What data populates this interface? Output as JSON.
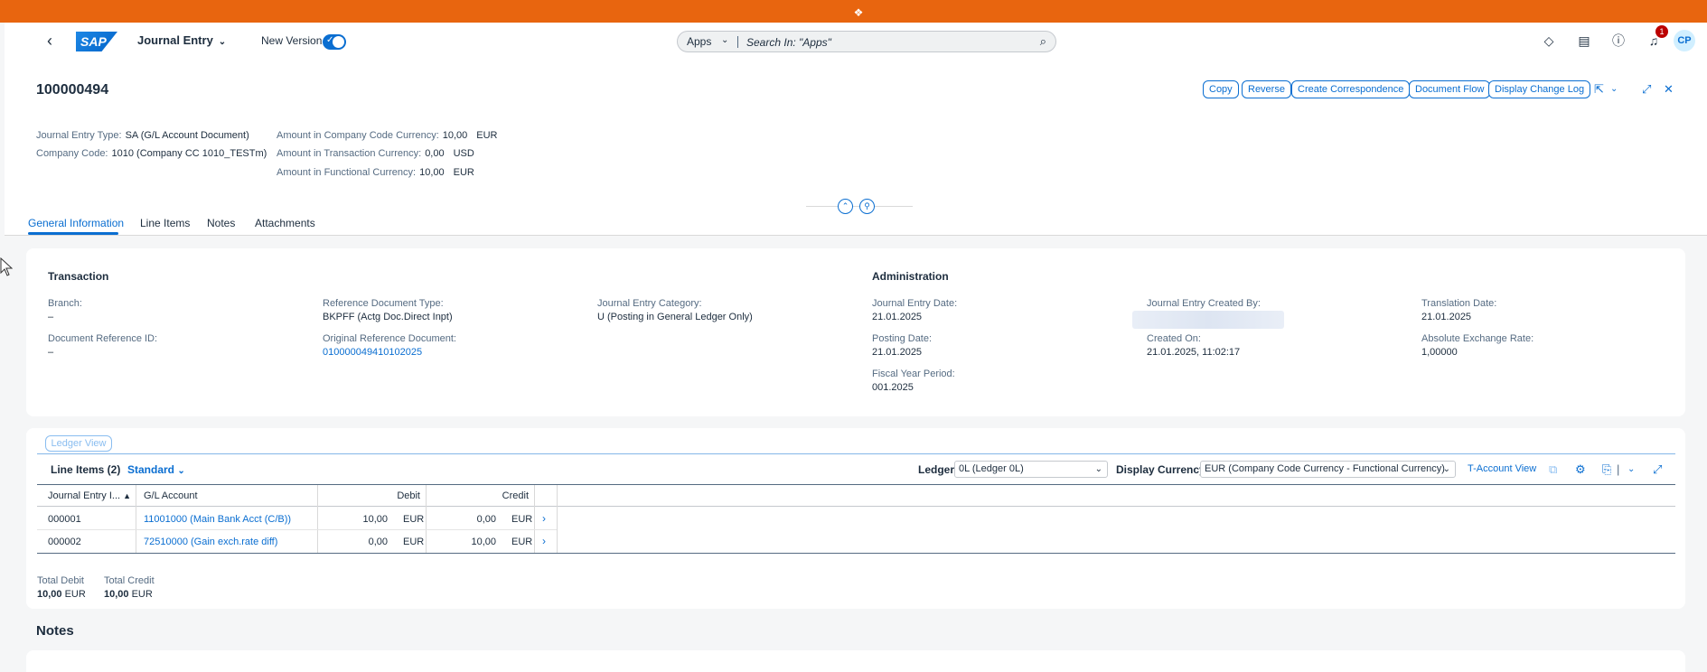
{
  "shell": {
    "app_title": "Journal Entry",
    "new_version_label": "New Version",
    "search_scope": "Apps",
    "search_placeholder": "Search In: \"Apps\"",
    "notification_count": "1",
    "avatar_initials": "CP"
  },
  "header": {
    "document_number": "100000494",
    "actions": [
      "Copy",
      "Reverse",
      "Create Correspondence",
      "Document Flow",
      "Display Change Log"
    ],
    "attributes": {
      "je_type_label": "Journal Entry Type:",
      "je_type_value": "SA (G/L Account Document)",
      "company_code_label": "Company Code:",
      "company_code_value": "1010 (Company CC 1010_TESTm)",
      "amt_cc_label": "Amount in Company Code Currency:",
      "amt_cc_value": "10,00",
      "amt_cc_currency": "EUR",
      "amt_tc_label": "Amount in Transaction Currency:",
      "amt_tc_value": "0,00",
      "amt_tc_currency": "USD",
      "amt_fc_label": "Amount in Functional Currency:",
      "amt_fc_value": "10,00",
      "amt_fc_currency": "EUR"
    }
  },
  "tabs": [
    "General Information",
    "Line Items",
    "Notes",
    "Attachments"
  ],
  "general": {
    "transaction_title": "Transaction",
    "administration_title": "Administration",
    "branch_label": "Branch:",
    "branch_value": "–",
    "doc_ref_label": "Document Reference ID:",
    "doc_ref_value": "–",
    "ref_doc_type_label": "Reference Document Type:",
    "ref_doc_type_value": "BKPFF (Actg Doc.Direct Inpt)",
    "orig_ref_label": "Original Reference Document:",
    "orig_ref_value": "010000049410102025",
    "je_category_label": "Journal Entry Category:",
    "je_category_value": "U (Posting in General Ledger Only)",
    "je_date_label": "Journal Entry Date:",
    "je_date_value": "21.01.2025",
    "posting_date_label": "Posting Date:",
    "posting_date_value": "21.01.2025",
    "fiscal_label": "Fiscal Year Period:",
    "fiscal_value": "001.2025",
    "created_by_label": "Journal Entry Created By:",
    "created_on_label": "Created On:",
    "created_on_value": "21.01.2025, 11:02:17",
    "translation_label": "Translation Date:",
    "translation_value": "21.01.2025",
    "exch_rate_label": "Absolute Exchange Rate:",
    "exch_rate_value": "1,00000"
  },
  "line_items": {
    "ledger_view_label": "Ledger View",
    "title": "Line Items (2)",
    "variant": "Standard",
    "ledger_label": "Ledger",
    "ledger_value": "0L (Ledger 0L)",
    "display_currency_label": "Display Currency",
    "display_currency_value": "EUR (Company Code Currency - Functional Currency)",
    "t_account_label": "T-Account View",
    "columns": {
      "item": "Journal Entry I...",
      "gl": "G/L Account",
      "debit": "Debit",
      "credit": "Credit"
    },
    "rows": [
      {
        "item": "000001",
        "gl": "11001000 (Main Bank Acct (C/B))",
        "debit": "10,00",
        "debit_cur": "EUR",
        "credit": "0,00",
        "credit_cur": "EUR"
      },
      {
        "item": "000002",
        "gl": "72510000 (Gain exch.rate diff)",
        "debit": "0,00",
        "debit_cur": "EUR",
        "credit": "10,00",
        "credit_cur": "EUR"
      }
    ],
    "total_debit_label": "Total Debit",
    "total_debit_value": "10,00",
    "total_debit_cur": "EUR",
    "total_credit_label": "Total Credit",
    "total_credit_value": "10,00",
    "total_credit_cur": "EUR"
  },
  "notes_title": "Notes"
}
